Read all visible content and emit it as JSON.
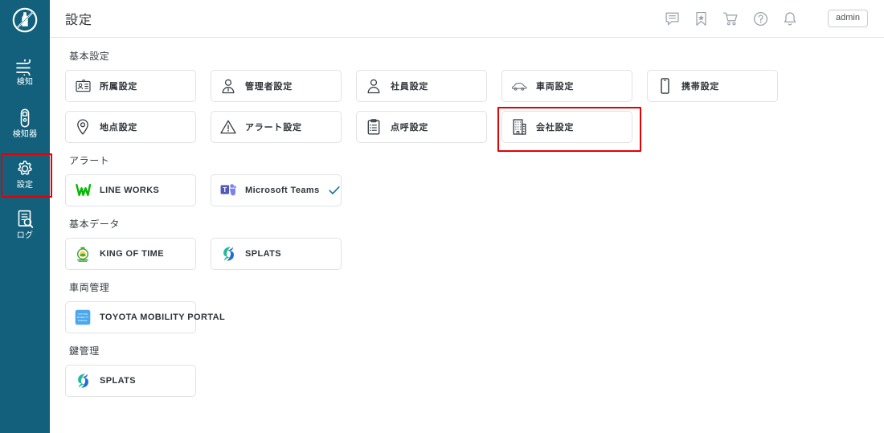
{
  "app": {
    "logo_name": "no-alcohol-logo",
    "accent_sidebar": "#12607c",
    "highlight_color": "#e60000",
    "check_color": "#1f7a99"
  },
  "header": {
    "title": "設定",
    "icons": [
      {
        "name": "chat-icon",
        "label": "chat"
      },
      {
        "name": "bookmark-icon",
        "label": "bookmark"
      },
      {
        "name": "cart-icon",
        "label": "cart"
      },
      {
        "name": "help-icon",
        "label": "help"
      },
      {
        "name": "bell-icon",
        "label": "notifications"
      }
    ],
    "admin_label": "admin"
  },
  "sidebar": {
    "items": [
      {
        "label": "検知",
        "icon": "wind-detect-icon",
        "active": false
      },
      {
        "label": "検知器",
        "icon": "device-icon",
        "active": false
      },
      {
        "label": "設定",
        "icon": "gear-icon",
        "active": true
      },
      {
        "label": "ログ",
        "icon": "log-document-icon",
        "active": false
      }
    ]
  },
  "sections": [
    {
      "title": "基本設定",
      "rows": [
        [
          {
            "label": "所属設定",
            "icon": "id-card-icon"
          },
          {
            "label": "管理者設定",
            "icon": "admin-user-icon"
          },
          {
            "label": "社員設定",
            "icon": "user-icon"
          },
          {
            "label": "車両設定",
            "icon": "car-icon"
          },
          {
            "label": "携帯設定",
            "icon": "smartphone-icon"
          }
        ],
        [
          {
            "label": "地点設定",
            "icon": "map-pin-icon"
          },
          {
            "label": "アラート設定",
            "icon": "warning-triangle-icon"
          },
          {
            "label": "点呼設定",
            "icon": "clipboard-icon"
          },
          {
            "label": "会社設定",
            "icon": "building-icon",
            "highlighted": true
          }
        ]
      ]
    },
    {
      "title": "アラート",
      "rows": [
        [
          {
            "label": "LINE WORKS",
            "icon": "line-works-logo"
          },
          {
            "label": "Microsoft Teams",
            "icon": "ms-teams-logo",
            "checked": true
          }
        ]
      ]
    },
    {
      "title": "基本データ",
      "rows": [
        [
          {
            "label": "KING OF TIME",
            "icon": "king-of-time-logo"
          },
          {
            "label": "SPLATS",
            "icon": "splats-logo"
          }
        ]
      ]
    },
    {
      "title": "車両管理",
      "rows": [
        [
          {
            "label": "TOYOTA MOBILITY PORTAL",
            "icon": "toyota-mobility-logo"
          }
        ]
      ]
    },
    {
      "title": "鍵管理",
      "rows": [
        [
          {
            "label": "SPLATS",
            "icon": "splats-logo"
          }
        ]
      ]
    }
  ]
}
